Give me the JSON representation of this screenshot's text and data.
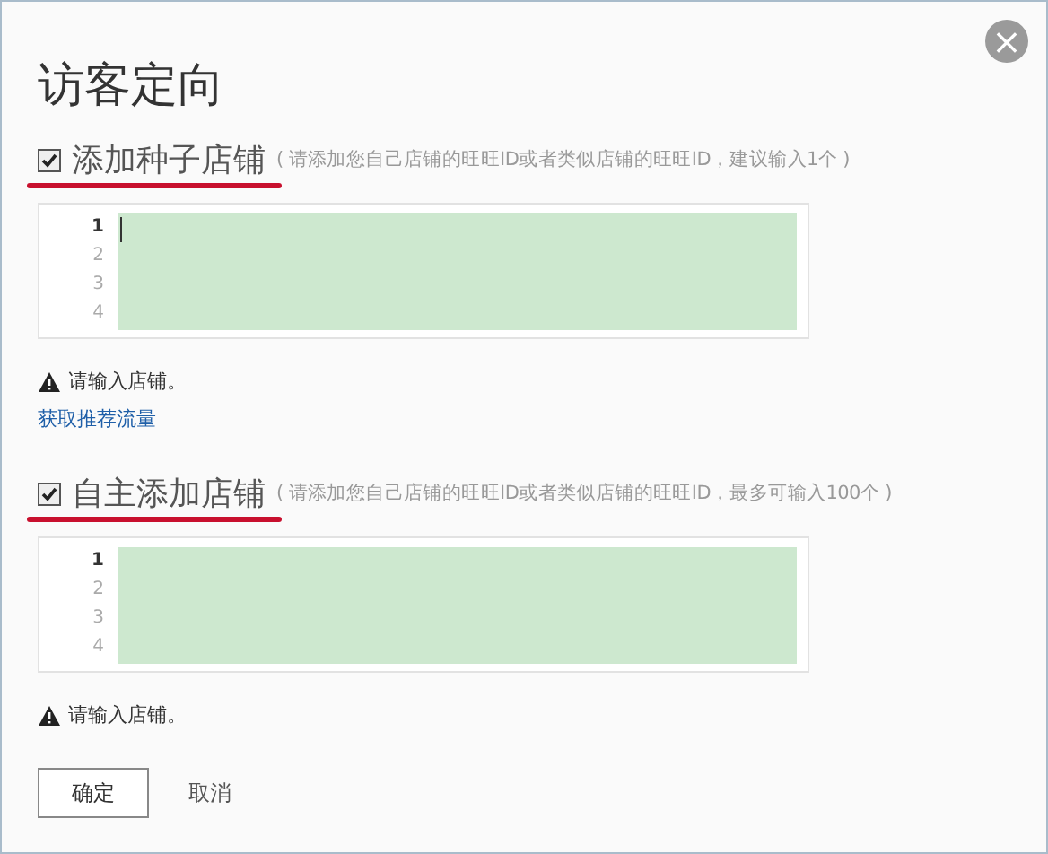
{
  "dialog": {
    "title": "访客定向",
    "close_button": "×"
  },
  "sections": [
    {
      "label": "添加种子店铺",
      "checked": true,
      "underlined": true,
      "hint": "( 请添加您自己店铺的旺旺ID或者类似店铺的旺旺ID，建议输入1个 )",
      "editor": {
        "focused": true,
        "lines": [
          {
            "number": "1",
            "current": true
          },
          {
            "number": "2",
            "current": false
          },
          {
            "number": "3",
            "current": false
          },
          {
            "number": "4",
            "current": false
          }
        ]
      },
      "warning": "请输入店铺。",
      "link": "获取推荐流量"
    },
    {
      "label": "自主添加店铺",
      "checked": true,
      "underlined": true,
      "hint": "( 请添加您自己店铺的旺旺ID或者类似店铺的旺旺ID，最多可输入100个 )",
      "editor": {
        "focused": false,
        "lines": [
          {
            "number": "1",
            "current": true
          },
          {
            "number": "2",
            "current": false
          },
          {
            "number": "3",
            "current": false
          },
          {
            "number": "4",
            "current": false
          }
        ]
      },
      "warning": "请输入店铺。"
    }
  ],
  "buttons": {
    "confirm": "确定",
    "cancel": "取消"
  }
}
